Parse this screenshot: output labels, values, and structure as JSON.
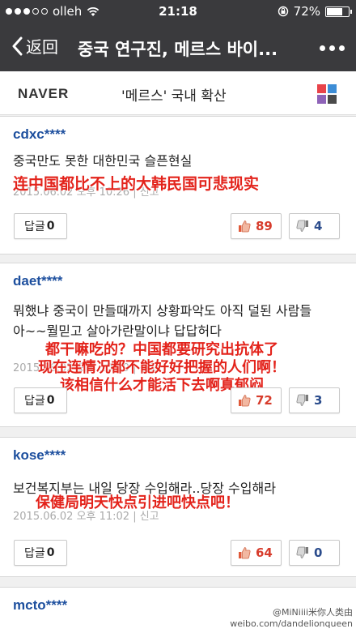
{
  "status": {
    "carrier": "olleh",
    "time": "21:18",
    "battery": "72%",
    "battery_level": 0.72
  },
  "nav": {
    "back_label": "返回",
    "title": "중국 연구진, 메르스 바이..."
  },
  "header": {
    "logo": "NAVER",
    "section": "'메르스' 국내 확산",
    "grid_colors": [
      "#e8434a",
      "#3d8dd6",
      "#8e63b8",
      "#4a4a4a"
    ]
  },
  "reply_label": "답글",
  "comments": [
    {
      "user": "cdxc****",
      "text": [
        "중국만도 못한 대한민국 슬픈현실"
      ],
      "meta": "2015.06.02 오후 10:26 | 신고",
      "overlay": [
        "连中国都比不上的大韩民国可悲现实"
      ],
      "replies": "0",
      "likes": "89",
      "dislikes": "4"
    },
    {
      "user": "daet****",
      "text": [
        "뭐했냐 중국이 만들때까지 상황파악도 아직 덜된 사람들",
        "아~~뭘믿고 살아가란말이냐 답답허다"
      ],
      "meta": "2015.06.02 오후 10:19 | 신고",
      "overlay": [
        "都干嘛吃的？中国都要研究出抗体了",
        "现在连情况都不能好好把握的人们啊！",
        "该相信什么才能活下去啊真郁闷"
      ],
      "replies": "0",
      "likes": "72",
      "dislikes": "3"
    },
    {
      "user": "kose****",
      "text": [
        "보건복지부는 내일 당장 수입해라..당장 수입해라"
      ],
      "meta": "2015.06.02 오후 11:02 | 신고",
      "overlay": [
        "保健局明天快点引进吧快点吧！"
      ],
      "replies": "0",
      "likes": "64",
      "dislikes": "0"
    },
    {
      "user": "mcto****"
    }
  ],
  "watermark": {
    "line1": "@MiNiiii米你人类由",
    "line2": "weibo.com/dandelionqueen"
  }
}
